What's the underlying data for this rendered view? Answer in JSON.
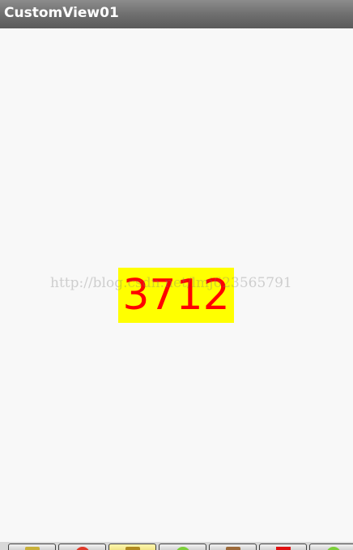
{
  "app": {
    "title": "CustomView01"
  },
  "custom_view": {
    "number": "3712",
    "background_color": "#ffff00",
    "text_color": "#ff0000"
  },
  "watermark": {
    "text": "http://blog.csdn.net/lmj623565791"
  },
  "taskbar": {
    "items": [
      {
        "icon": "folder-icon",
        "color": "#c8b03a"
      },
      {
        "icon": "red-circle-icon",
        "color": "#e03a2a"
      },
      {
        "icon": "folder-open-icon",
        "color": "#b08a20"
      },
      {
        "icon": "green-circle-icon",
        "color": "#7ccf3a"
      },
      {
        "icon": "document-icon",
        "color": "#9c6a3a"
      },
      {
        "icon": "red-square-icon",
        "color": "#e01010"
      },
      {
        "icon": "green-circle-icon",
        "color": "#7ccf3a"
      }
    ]
  }
}
